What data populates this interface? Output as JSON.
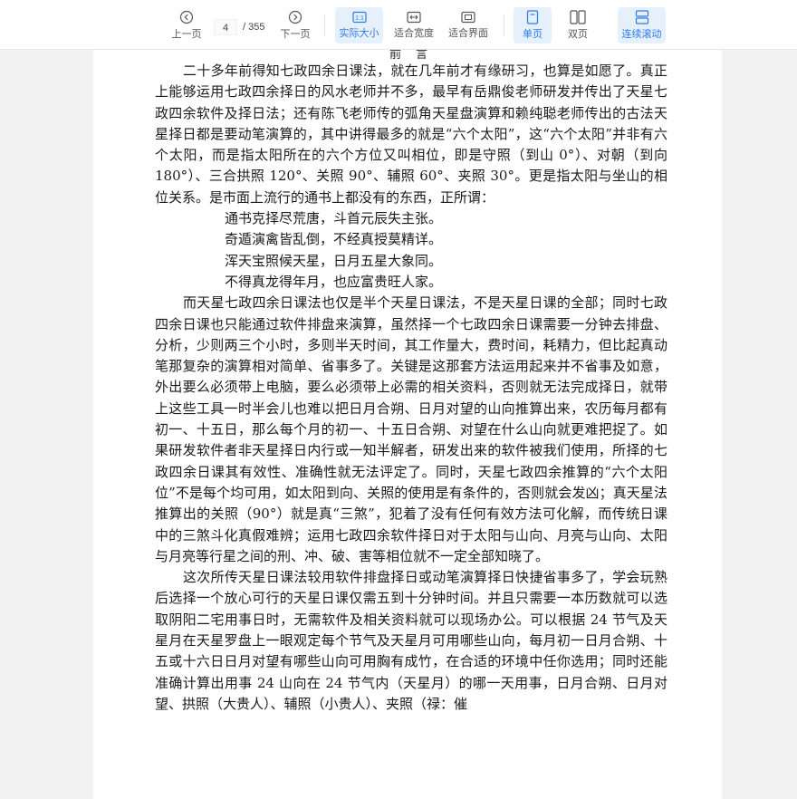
{
  "toolbar": {
    "prev_label": "上一页",
    "next_label": "下一页",
    "current_page": "4",
    "total_pages": "/ 355",
    "actual_size_label": "实际大小",
    "fit_width_label": "适合宽度",
    "fit_page_label": "适合界面",
    "single_page_label": "单页",
    "double_page_label": "双页",
    "continuous_label": "连续滚动",
    "accent_color": "#2c7be5",
    "active_bg": "#e6f0fb"
  },
  "document": {
    "heading": "前言",
    "paragraphs": [
      "二十多年前得知七政四余日课法，就在几年前才有缘研习，也算是如愿了。真正上能够运用七政四余择日的风水老师并不多，最早有岳鼎俊老师研发并传出了天星七政四余软件及择日法；还有陈飞老师传的弧角天星盘演算和赖纯聪老师传出的古法天星择日都是要动笔演算的，其中讲得最多的就是“六个太阳”，这“六个太阳”并非有六个太阳，而是指太阳所在的六个方位又叫相位，即是守照（到山 0°）、对朝（到向 180°）、三合拱照 120°、关照 90°、辅照 60°、夹照 30°。更是指太阳与坐山的相位关系。是市面上流行的通书上都没有的东西，正所谓：",
      "而天星七政四余日课法也仅是半个天星日课法，不是天星日课的全部；同时七政四余日课也只能通过软件排盘来演算，虽然择一个七政四余日课需要一分钟去排盘、分析，少则两三个小时，多则半天时间，其工作量大，费时间，耗精力，但比起真动笔那复杂的演算相对简单、省事多了。关键是这那套方法运用起来并不省事及如意，外出要么必须带上电脑，要么必须带上必需的相关资料，否则就无法完成择日，就带上这些工具一时半会儿也难以把日月合朔、日月对望的山向推算出来，农历每月都有初一、十五日，那么每个月的初一、十五日合朔、对望在什么山向就更难把捉了。如果研发软件者非天星择日内行或一知半解者，研发出来的软件被我们使用，所择的七政四余日课其有效性、准确性就无法评定了。同时，天星七政四余推算的“六个太阳位”不是每个均可用，如太阳到向、关照的使用是有条件的，否则就会发凶；真天星法推算出的关照（90°）就是真“三煞”，犯着了没有任何有效方法可化解，而传统日课中的三煞斗化真假难辨；运用七政四余软件择日对于太阳与山向、月亮与山向、太阳与月亮等行星之间的刑、冲、破、害等相位就不一定全部知晓了。",
      "这次所传天星日课法较用软件排盘择日或动笔演算择日快捷省事多了，学会玩熟后选择一个放心可行的天星日课仅需五到十分钟时间。并且只需要一本历数就可以选取阴阳二宅用事日时，无需软件及相关资料就可以现场办公。可以根据 24 节气及天星月在天星罗盘上一眼观定每个节气及天星月可用哪些山向，每月初一日月合朔、十五或十六日日月对望有哪些山向可用胸有成竹，在合适的环境中任你选用；同时还能准确计算出用事 24 山向在 24 节气内（天星月）的哪一天用事，日月合朔、日月对望、拱照（大贵人）、辅照（小贵人）、夹照（禄：催"
    ],
    "verses": [
      "通书克择尽荒唐，斗首元辰失主张。",
      "奇遁演禽皆乱倒，不经真授莫精详。",
      "浑天宝照候天星，日月五星大象同。",
      "不得真龙得年月，也应富贵旺人家。"
    ]
  }
}
